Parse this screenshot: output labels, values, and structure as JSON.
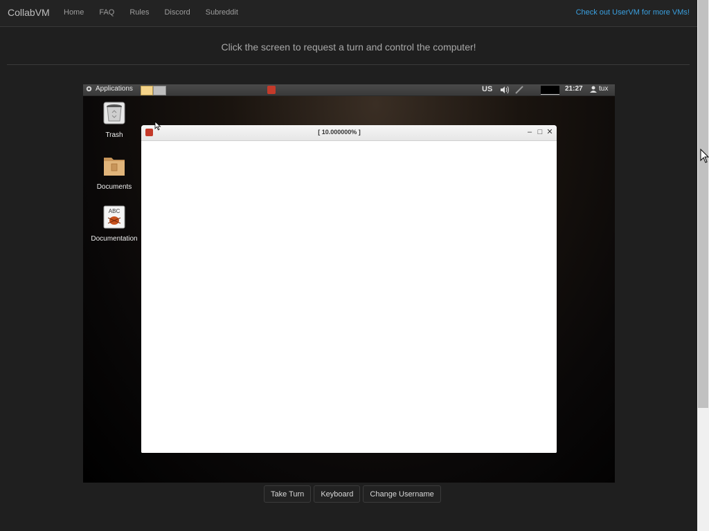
{
  "navbar": {
    "brand": "CollabVM",
    "links": [
      "Home",
      "FAQ",
      "Rules",
      "Discord",
      "Subreddit"
    ],
    "promo": "Check out UserVM for more VMs!"
  },
  "headline": "Click the screen to request a turn and control the computer!",
  "vm": {
    "panel": {
      "applications_label": "Applications",
      "keyboard_layout": "US",
      "clock": "21:27",
      "user": "tux"
    },
    "desktop_icons": [
      {
        "label": "Trash",
        "icon": "trash-icon"
      },
      {
        "label": "Documents",
        "icon": "folder-icon"
      },
      {
        "label": "Documentation",
        "icon": "documentation-icon"
      }
    ],
    "window": {
      "title": "[ 10.000000% ]",
      "minimize": "‒",
      "maximize": "□",
      "close": "✕"
    }
  },
  "controls": {
    "take_turn": "Take Turn",
    "keyboard": "Keyboard",
    "change_username": "Change Username"
  },
  "colors": {
    "background": "#1f1f1f",
    "navbar": "#232323",
    "promo_link": "#3aa0e0"
  }
}
